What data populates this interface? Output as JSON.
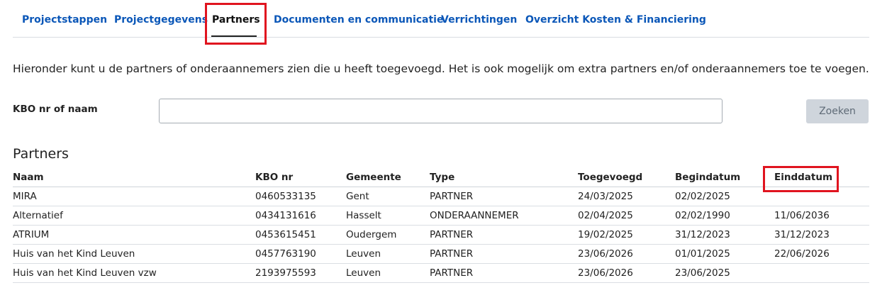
{
  "tabs": [
    {
      "label": "Projectstappen"
    },
    {
      "label": "Projectgegevens"
    },
    {
      "label": "Partners",
      "active": true
    },
    {
      "label": "Documenten en communicatie"
    },
    {
      "label": "Verrichtingen"
    },
    {
      "label": "Overzicht Kosten & Financiering"
    }
  ],
  "intro_text": "Hieronder kunt u de partners of onderaannemers zien die u heeft toegevoegd. Het is ook mogelijk om extra partners en/of onderaannemers toe te voegen.",
  "search": {
    "label": "KBO nr of naam",
    "value": "",
    "button_label": "Zoeken"
  },
  "partners": {
    "title": "Partners",
    "columns": [
      "Naam",
      "KBO nr",
      "Gemeente",
      "Type",
      "Toegevoegd",
      "Begindatum",
      "Einddatum"
    ],
    "rows": [
      [
        "MIRA",
        "0460533135",
        "Gent",
        "PARTNER",
        "24/03/2025",
        "02/02/2025",
        ""
      ],
      [
        "Alternatief",
        "0434131616",
        "Hasselt",
        "ONDERAANNEMER",
        "02/04/2025",
        "02/02/1990",
        "11/06/2036"
      ],
      [
        "ATRIUM",
        "0453615451",
        "Oudergem",
        "PARTNER",
        "19/02/2025",
        "31/12/2023",
        "31/12/2023"
      ],
      [
        "Huis van het Kind Leuven",
        "0457763190",
        "Leuven",
        "PARTNER",
        "23/06/2026",
        "01/01/2025",
        "22/06/2026"
      ],
      [
        "Huis van het Kind Leuven vzw",
        "2193975593",
        "Leuven",
        "PARTNER",
        "23/06/2026",
        "23/06/2025",
        ""
      ]
    ]
  },
  "colors": {
    "tab_link": "#0b57b8",
    "highlight": "#e0141f",
    "button_bg": "#cfd5dc"
  }
}
